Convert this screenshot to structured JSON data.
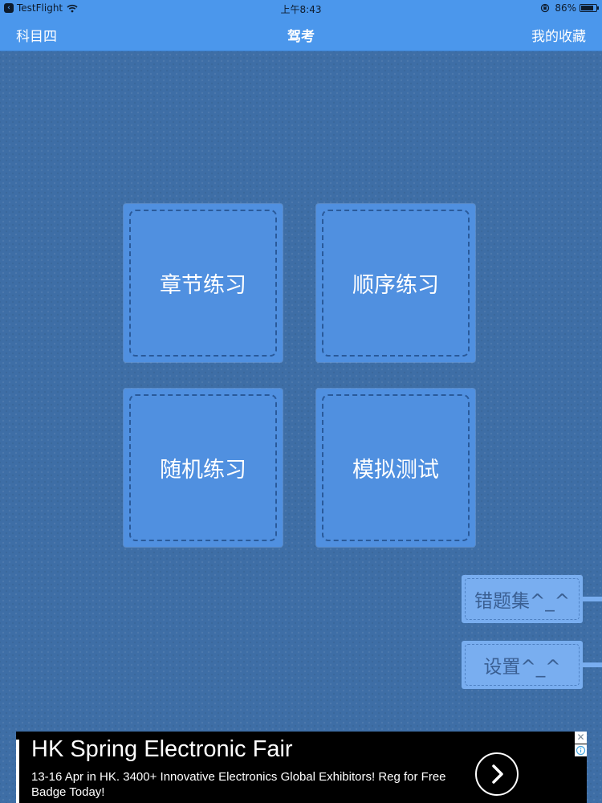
{
  "status_bar": {
    "back_app": "TestFlight",
    "time": "上午8:43",
    "battery": "86%",
    "battery_level": 0.86
  },
  "nav": {
    "left": "科目四",
    "title": "驾考",
    "right": "我的收藏"
  },
  "tiles": [
    {
      "label": "章节练习"
    },
    {
      "label": "顺序练习"
    },
    {
      "label": "随机练习"
    },
    {
      "label": "模拟测试"
    }
  ],
  "side_tabs": [
    {
      "label": "错题集^_^"
    },
    {
      "label": "设置^_^"
    }
  ],
  "ad": {
    "title": "HK Spring Electronic Fair",
    "body": "13-16 Apr in HK. 3400+ Innovative Electronics Global Exhibitors! Reg for Free Badge Today!",
    "close": "✕"
  },
  "colors": {
    "bar_blue": "#4b97ec",
    "background": "#3e6ea6",
    "tile": "#5090e0",
    "side_tab": "#79aef0",
    "ad_background": "#000000"
  }
}
